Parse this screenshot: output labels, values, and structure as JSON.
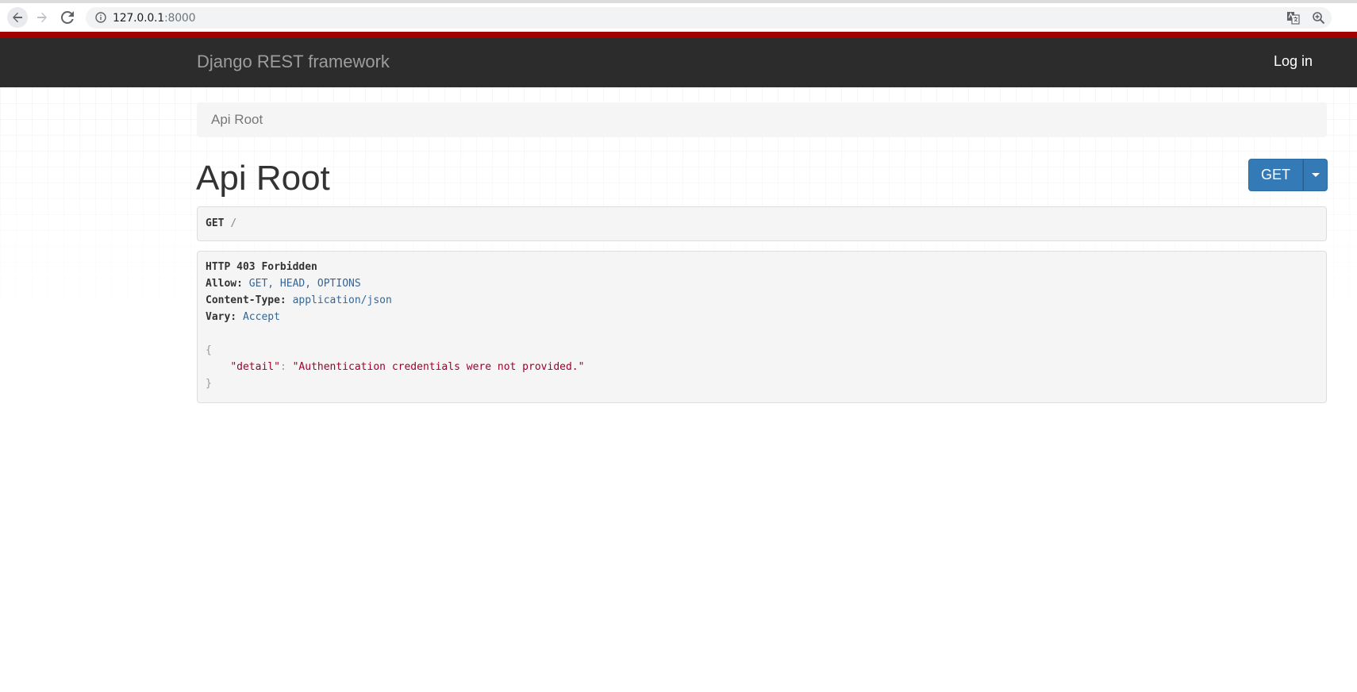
{
  "browser": {
    "url_host": "127.0.0.1",
    "url_port": ":8000"
  },
  "navbar": {
    "brand": "Django REST framework",
    "login_label": "Log in"
  },
  "breadcrumb": {
    "items": [
      {
        "label": "Api Root"
      }
    ]
  },
  "page": {
    "title": "Api Root",
    "method_button": "GET"
  },
  "request": {
    "method": "GET",
    "path": "/"
  },
  "response": {
    "status": "HTTP 403 Forbidden",
    "headers": [
      {
        "key": "Allow:",
        "value": "GET, HEAD, OPTIONS"
      },
      {
        "key": "Content-Type:",
        "value": "application/json"
      },
      {
        "key": "Vary:",
        "value": "Accept"
      }
    ],
    "body_open": "{",
    "body_key": "\"detail\"",
    "body_sep": ": ",
    "body_value": "\"Authentication credentials were not provided.\"",
    "body_close": "}"
  },
  "colors": {
    "navbar_bg": "#2c2c2c",
    "accent_red": "#a30000",
    "primary_button": "#337ab7"
  }
}
